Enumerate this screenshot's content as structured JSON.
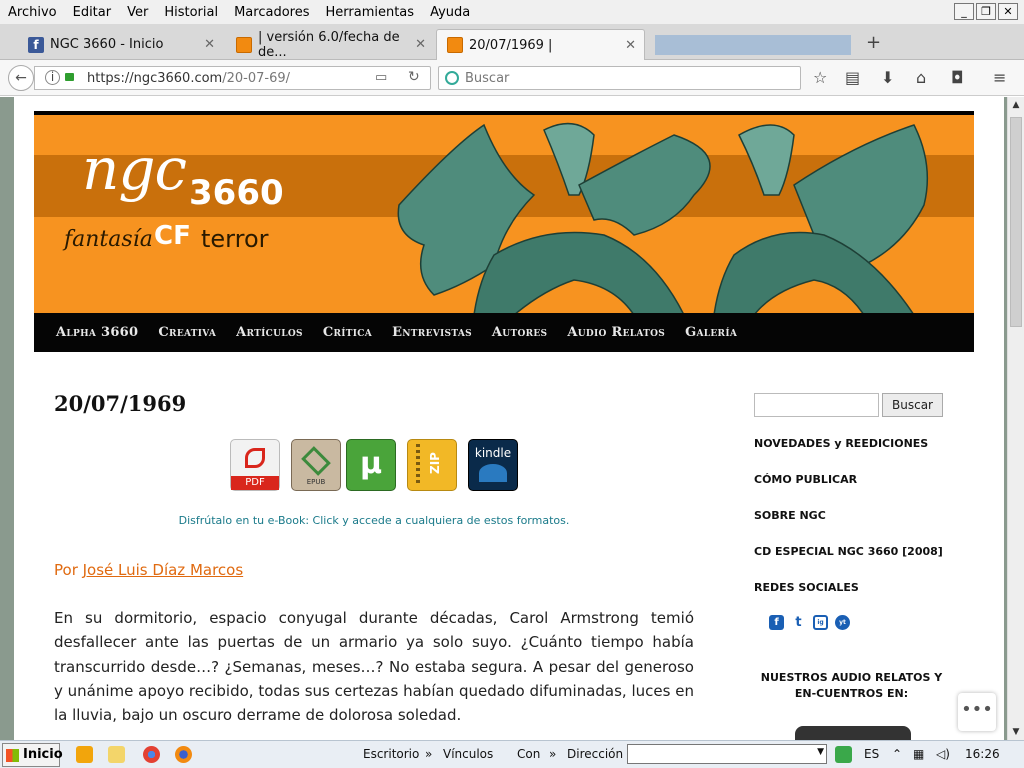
{
  "menubar": {
    "items": [
      "Archivo",
      "Editar",
      "Ver",
      "Historial",
      "Marcadores",
      "Herramientas",
      "Ayuda"
    ]
  },
  "tabs": [
    {
      "label": "NGC 3660 - Inicio"
    },
    {
      "label": "| versión 6.0/fecha de de..."
    },
    {
      "label": "20/07/1969 |"
    }
  ],
  "urlbar": {
    "url_domain": "https://ngc3660.com",
    "url_path": "/20-07-69/",
    "search_placeholder": "Buscar"
  },
  "banner": {
    "logo_ngc": "ngc",
    "logo_num": "3660",
    "logo_fantasia": "fantasía",
    "logo_cf": "CF",
    "logo_terror": "terror"
  },
  "site_nav": [
    "Alpha 3660",
    "Creativa",
    "Artículos",
    "Crítica",
    "Entrevistas",
    "Autores",
    "Audio Relatos",
    "Galería"
  ],
  "post": {
    "title": "20/07/1969",
    "ebook_formats": [
      "PDF",
      "EPUB",
      "µ",
      "ZIP",
      "kindle"
    ],
    "ebook_caption": "Disfrútalo en tu e-Book: Click y accede a cualquiera de estos formatos.",
    "byline_prefix": "Por ",
    "author": "José Luis Díaz Marcos",
    "body": "En su dormitorio, espacio conyugal durante décadas, Carol Armstrong temió desfallecer ante las puertas de un armario ya solo suyo. ¿Cuánto tiempo había transcurrido desde…? ¿Semanas, meses…? No estaba segura. A pesar del generoso y unánime apoyo recibido, todas sus certezas habían quedado difuminadas, luces en la lluvia, bajo un oscuro derrame de dolorosa soledad."
  },
  "sidebar": {
    "search_button": "Buscar",
    "links": [
      "NOVEDADES y REEDICIONES",
      "CÓMO PUBLICAR",
      "SOBRE NGC",
      "CD ESPECIAL NGC 3660 [2008]",
      "REDES SOCIALES"
    ],
    "social": [
      "f",
      "t",
      "ig",
      "yt"
    ],
    "audio_heading": "NUESTROS AUDIO RELATOS Y EN-CUENTROS EN:"
  },
  "taskbar": {
    "start": "Inicio",
    "items": [
      "Escritorio",
      "Vínculos",
      "Con",
      "Dirección"
    ],
    "lang": "ES",
    "clock": "16:26"
  },
  "colors": {
    "banner_orange": "#f79320",
    "accent_link": "#e06a10",
    "nav_bg": "#050505"
  }
}
